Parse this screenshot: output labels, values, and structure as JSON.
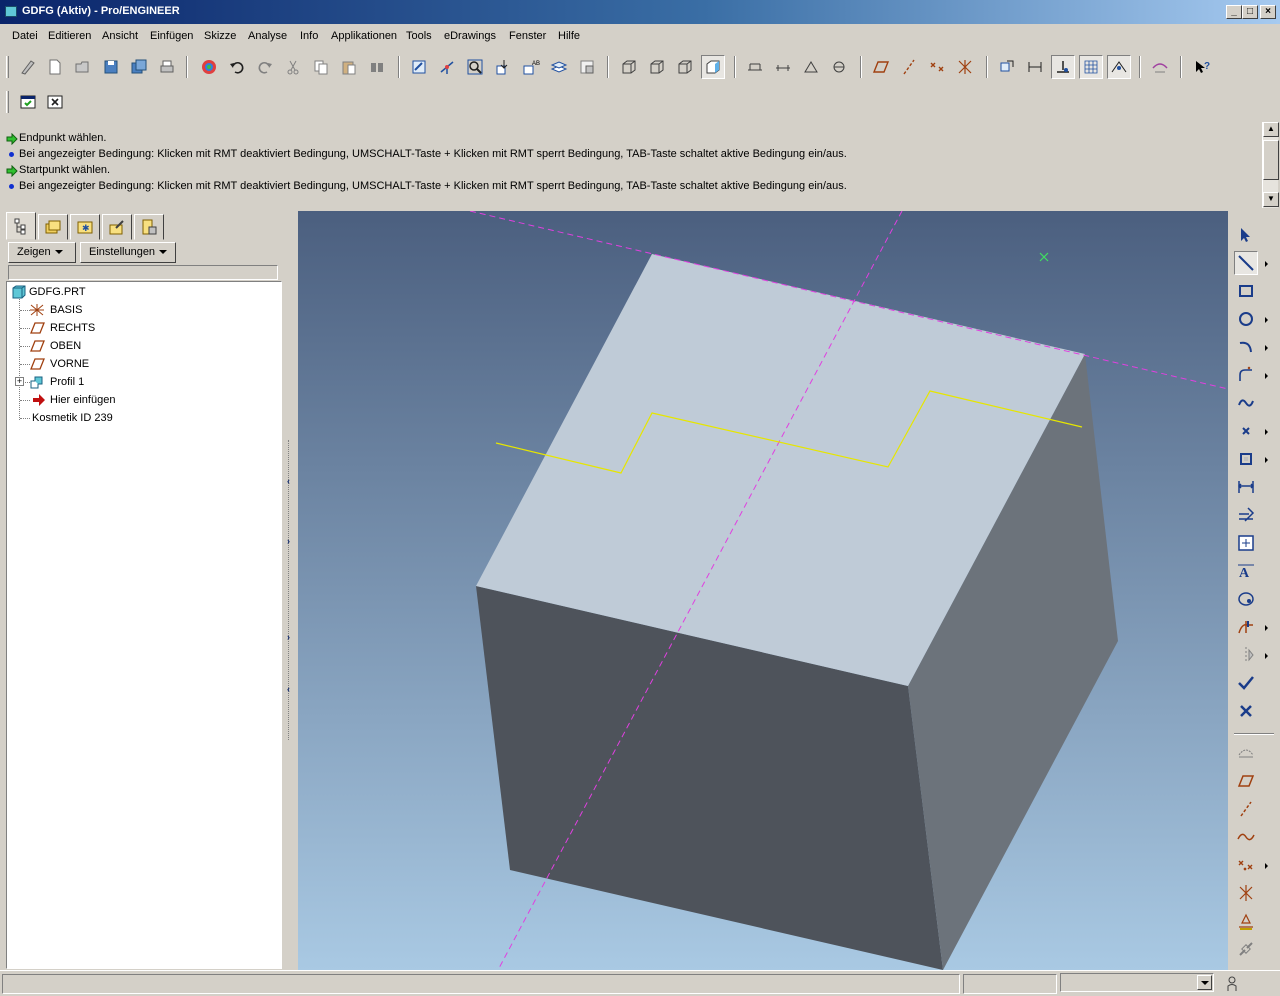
{
  "window": {
    "title": "GDFG (Aktiv) - Pro/ENGINEER",
    "minimize": "_",
    "maximize": "□",
    "close": "×"
  },
  "menu": [
    "Datei",
    "Editieren",
    "Ansicht",
    "Einfügen",
    "Skizze",
    "Analyse",
    "Info",
    "Applikationen",
    "Tools",
    "eDrawings",
    "Fenster",
    "Hilfe"
  ],
  "messages": [
    {
      "type": "prompt",
      "text": "Endpunkt wählen."
    },
    {
      "type": "info",
      "text": "Bei angezeigter Bedingung: Klicken mit RMT deaktiviert Bedingung, UMSCHALT-Taste + Klicken mit RMT sperrt Bedingung, TAB-Taste schaltet aktive Bedingung ein/aus."
    },
    {
      "type": "prompt",
      "text": "Startpunkt wählen."
    },
    {
      "type": "info",
      "text": "Bei angezeigter Bedingung: Klicken mit RMT deaktiviert Bedingung, UMSCHALT-Taste + Klicken mit RMT sperrt Bedingung, TAB-Taste schaltet aktive Bedingung ein/aus."
    }
  ],
  "navigator": {
    "tabs": [
      "model-tree-icon",
      "layers-icon",
      "favorites-icon",
      "tools-icon",
      "connections-icon"
    ],
    "show_label": "Zeigen",
    "settings_label": "Einstellungen",
    "tree": [
      {
        "label": "GDFG.PRT",
        "icon": "part-icon"
      },
      {
        "label": "BASIS",
        "icon": "coordinate-system-icon"
      },
      {
        "label": "RECHTS",
        "icon": "datum-plane-icon"
      },
      {
        "label": "OBEN",
        "icon": "datum-plane-icon"
      },
      {
        "label": "VORNE",
        "icon": "datum-plane-icon"
      },
      {
        "label": "Profil 1",
        "icon": "extrude-feature-icon",
        "expander": "+"
      },
      {
        "label": "Hier einfügen",
        "icon": "insert-here-arrow-icon"
      },
      {
        "label": "Kosmetik ID 239",
        "icon": "none"
      }
    ]
  },
  "colors": {
    "viewport_top": "#4b5f7f",
    "viewport_bottom": "#a9c9e3",
    "cube_top": "#bfcbd7",
    "cube_front": "#4e535b",
    "cube_side": "#6c737b",
    "datum": "#e040e0",
    "sketch": "#e6e600"
  },
  "status": {
    "filter_value": ""
  }
}
